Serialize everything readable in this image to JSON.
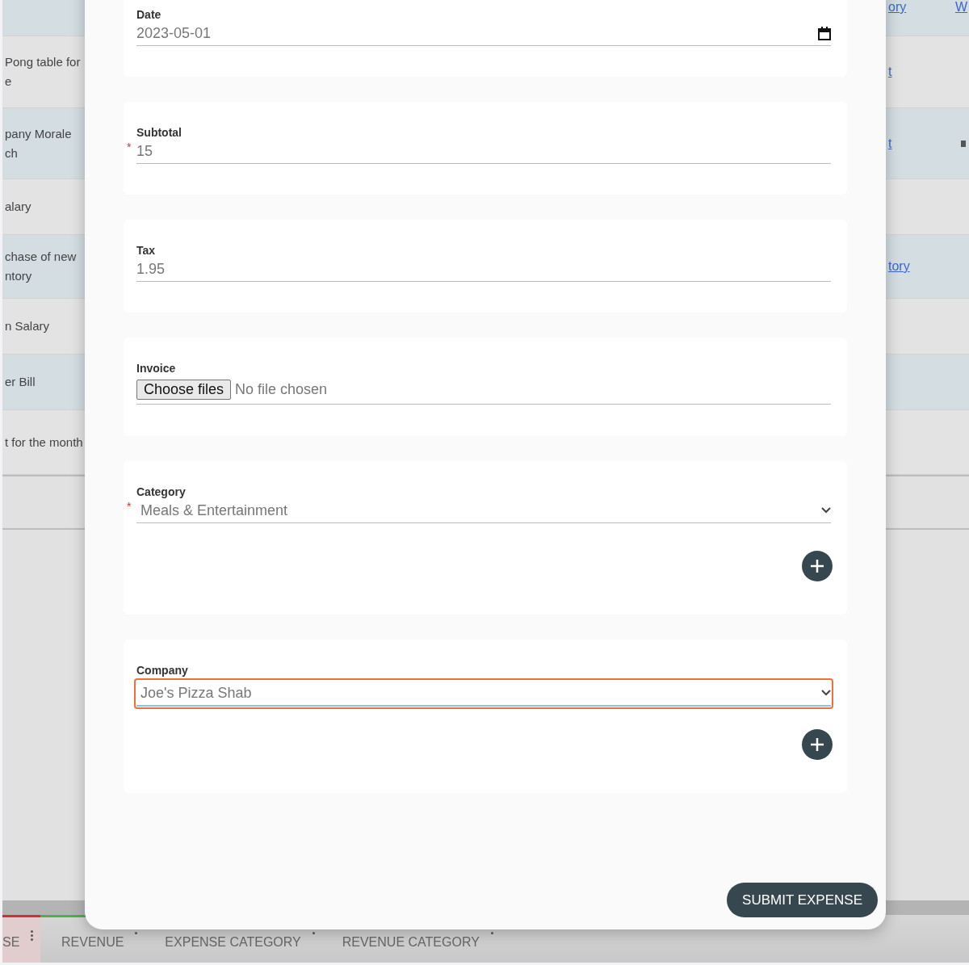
{
  "background_table": {
    "rows": [
      {
        "link": "ory",
        "extra_link": "W",
        "handle": false,
        "shaded": true
      },
      {
        "text": [
          "Pong table for",
          "e"
        ],
        "link": "t",
        "handle": false,
        "shaded": false
      },
      {
        "text": [
          "pany Morale",
          "ch"
        ],
        "link": "t",
        "handle": true,
        "shaded": true
      },
      {
        "text": [
          "alary"
        ],
        "handle": false,
        "shaded": false
      },
      {
        "text": [
          "chase of new",
          "ntory"
        ],
        "link": "tory",
        "handle": false,
        "shaded": true
      },
      {
        "text": [
          "n Salary"
        ],
        "handle": false,
        "shaded": false
      },
      {
        "text": [
          "er Bill"
        ],
        "handle": false,
        "shaded": true
      },
      {
        "text": [
          "t for the month"
        ],
        "handle": false,
        "shaded": false
      }
    ]
  },
  "tabs": [
    {
      "label": "SE",
      "selected": true,
      "color": "#d32f2f"
    },
    {
      "label": "REVENUE",
      "selected": false,
      "color": "#4caf50"
    },
    {
      "label": "EXPENSE CATEGORY",
      "selected": false
    },
    {
      "label": "REVENUE CATEGORY",
      "selected": false
    }
  ],
  "form": {
    "fields": [
      {
        "kind": "date",
        "label": "Date",
        "value": "2023-05-01"
      },
      {
        "kind": "text",
        "label": "Subtotal",
        "value": "15",
        "required_mark": "*"
      },
      {
        "kind": "text",
        "label": "Tax",
        "value": "1.95"
      },
      {
        "kind": "file",
        "label": "Invoice",
        "button": "Choose files",
        "value": "No file chosen"
      },
      {
        "kind": "select",
        "label": "Category",
        "value": "Meals & Entertainment",
        "required_mark": "*",
        "add_button": true,
        "focused": false
      },
      {
        "kind": "select",
        "label": "Company",
        "value": "Joe's Pizza Shab",
        "add_button": true,
        "focused": true
      }
    ],
    "submit": "SUBMIT EXPENSE"
  }
}
